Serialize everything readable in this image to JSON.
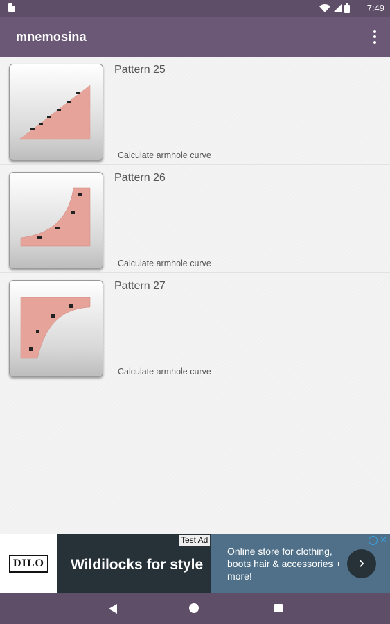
{
  "status_bar": {
    "time": "7:49",
    "icons": [
      "sd-card-icon",
      "wifi-icon",
      "signal-icon",
      "battery-icon"
    ]
  },
  "app_bar": {
    "title": "mnemosina",
    "menu_icon": "more-vert-icon"
  },
  "patterns": [
    {
      "name": "Pattern 25",
      "description": "Calculate armhole curve"
    },
    {
      "name": "Pattern 26",
      "description": "Calculate armhole curve"
    },
    {
      "name": "Pattern 27",
      "description": "Calculate armhole curve"
    }
  ],
  "ad": {
    "logo_text": "DILO",
    "headline": "Wildilocks for style",
    "badge": "Test Ad",
    "body": "Online store for clothing, boots hair & accessories + more!",
    "cta_icon": "chevron-right-icon",
    "info_icon": "info-icon",
    "close_icon": "close-icon"
  },
  "nav_bar": {
    "buttons": [
      "back-icon",
      "home-icon",
      "recents-icon"
    ]
  },
  "colors": {
    "status_bar": "#5f4e68",
    "app_bar": "#6b5876",
    "fabric": "#e6a39a",
    "ad_dark": "#263238",
    "ad_blue": "#4f7088"
  }
}
